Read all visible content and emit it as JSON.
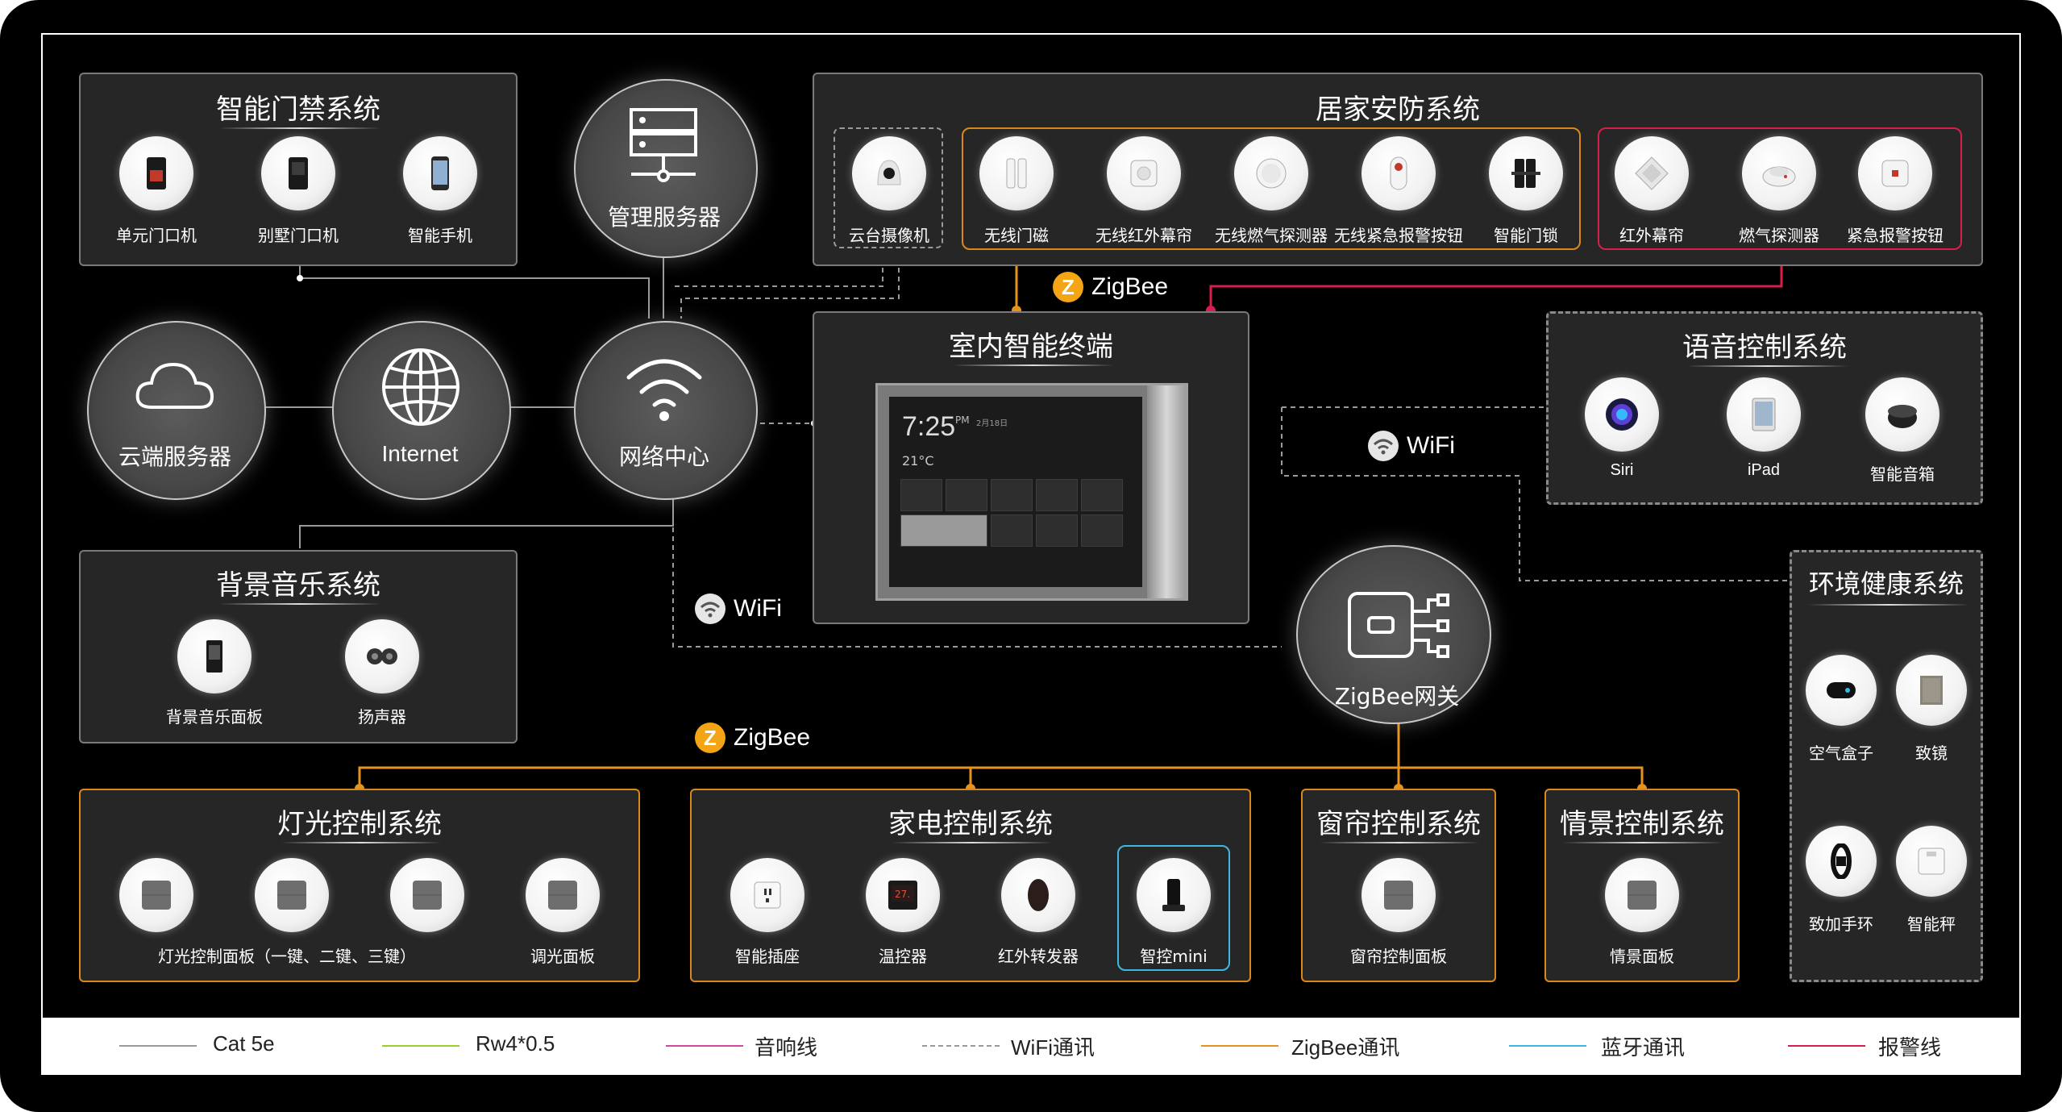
{
  "colors": {
    "background": "#000000",
    "panel": "#262626",
    "orange_line": "#e8921e",
    "red_line": "#d81e4c",
    "gray_line": "#9a9a9a",
    "green_line": "#9bcf2a",
    "magenta_line": "#d04aa5",
    "blue_line": "#3fb8e0"
  },
  "hubs": {
    "cloud": "云端服务器",
    "internet": "Internet",
    "network": "网络中心",
    "server": "管理服务器",
    "zigbee_gateway": "ZigBee网关"
  },
  "protocols": {
    "zigbee_top": "ZigBee",
    "zigbee_mid": "ZigBee",
    "wifi_left": "WiFi",
    "wifi_right": "WiFi"
  },
  "access": {
    "title": "智能门禁系统",
    "items": [
      {
        "label": "单元门口机",
        "icon": "intercom-icon"
      },
      {
        "label": "别墅门口机",
        "icon": "villa-intercom-icon"
      },
      {
        "label": "智能手机",
        "icon": "smartphone-icon"
      }
    ]
  },
  "security": {
    "title": "居家安防系统",
    "camera": {
      "label": "云台摄像机",
      "icon": "ptz-camera-icon"
    },
    "wireless": [
      {
        "label": "无线门磁",
        "icon": "door-sensor-icon"
      },
      {
        "label": "无线红外幕帘",
        "icon": "infrared-curtain-icon"
      },
      {
        "label": "无线燃气探测器",
        "icon": "gas-detector-icon"
      },
      {
        "label": "无线紧急报警按钮",
        "icon": "emergency-button-icon"
      },
      {
        "label": "智能门锁",
        "icon": "door-lock-icon"
      }
    ],
    "wired": [
      {
        "label": "红外幕帘",
        "icon": "infrared-icon"
      },
      {
        "label": "燃气探测器",
        "icon": "smoke-detector-icon"
      },
      {
        "label": "紧急报警按钮",
        "icon": "alarm-button-icon"
      }
    ]
  },
  "terminal": {
    "title": "室内智能终端",
    "time": "7:25",
    "ampm": "PM",
    "date": "2月18日",
    "temp": "21°C"
  },
  "voice": {
    "title": "语音控制系统",
    "items": [
      {
        "label": "Siri",
        "icon": "siri-icon"
      },
      {
        "label": "iPad",
        "icon": "ipad-icon"
      },
      {
        "label": "智能音箱",
        "icon": "smart-speaker-icon"
      }
    ]
  },
  "music": {
    "title": "背景音乐系统",
    "items": [
      {
        "label": "背景音乐面板",
        "icon": "music-panel-icon"
      },
      {
        "label": "扬声器",
        "icon": "speaker-icon"
      }
    ]
  },
  "env": {
    "title": "环境健康系统",
    "items": [
      {
        "label": "空气盒子",
        "icon": "air-box-icon"
      },
      {
        "label": "致镜",
        "icon": "mirror-icon"
      },
      {
        "label": "致加手环",
        "icon": "wristband-icon"
      },
      {
        "label": "智能秤",
        "icon": "scale-icon"
      }
    ]
  },
  "lighting": {
    "title": "灯光控制系统",
    "group_label": "灯光控制面板（一键、二键、三键）",
    "dimmer_label": "调光面板"
  },
  "appliance": {
    "title": "家电控制系统",
    "items": [
      {
        "label": "智能插座",
        "icon": "socket-icon"
      },
      {
        "label": "温控器",
        "icon": "thermostat-icon"
      },
      {
        "label": "红外转发器",
        "icon": "ir-repeater-icon"
      },
      {
        "label": "智控mini",
        "icon": "mini-controller-icon"
      }
    ]
  },
  "curtain": {
    "title": "窗帘控制系统",
    "item_label": "窗帘控制面板"
  },
  "scene": {
    "title": "情景控制系统",
    "item_label": "情景面板"
  },
  "legend": [
    {
      "label": "Cat 5e",
      "color": "#9a9a9a",
      "style": "solid"
    },
    {
      "label": "Rw4*0.5",
      "color": "#9bcf2a",
      "style": "solid"
    },
    {
      "label": "音响线",
      "color": "#d04aa5",
      "style": "solid"
    },
    {
      "label": "WiFi通讯",
      "color": "#9a9a9a",
      "style": "dashed"
    },
    {
      "label": "ZigBee通讯",
      "color": "#e8921e",
      "style": "solid"
    },
    {
      "label": "蓝牙通讯",
      "color": "#3fb8e0",
      "style": "solid"
    },
    {
      "label": "报警线",
      "color": "#d81e4c",
      "style": "solid"
    }
  ]
}
